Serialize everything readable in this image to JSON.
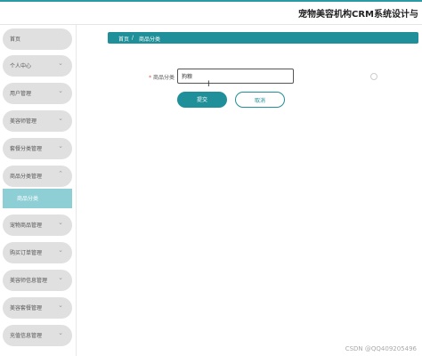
{
  "app": {
    "title": "宠物美容机构CRM系统设计与"
  },
  "sidebar": {
    "items": [
      {
        "label": "首页",
        "has_chevron": false
      },
      {
        "label": "个人中心",
        "has_chevron": true
      },
      {
        "label": "用户管理",
        "has_chevron": true
      },
      {
        "label": "美容师管理",
        "has_chevron": true
      },
      {
        "label": "套餐分类管理",
        "has_chevron": true
      },
      {
        "label": "商品分类管理",
        "has_chevron": true
      },
      {
        "label": "宠物商品管理",
        "has_chevron": true
      },
      {
        "label": "购买订单管理",
        "has_chevron": true
      },
      {
        "label": "美容师信息管理",
        "has_chevron": true
      },
      {
        "label": "美容套餐管理",
        "has_chevron": true
      },
      {
        "label": "充值信息管理",
        "has_chevron": true
      }
    ],
    "active_sub": {
      "label": "商品分类"
    }
  },
  "breadcrumb": {
    "home": "首页",
    "separator": "/",
    "current": "商品分类"
  },
  "form": {
    "label": "商品分类",
    "required_mark": "*",
    "value": "狗粮",
    "submit_label": "提交",
    "cancel_label": "取消"
  },
  "watermark": "CSDN @QQ409205496",
  "colors": {
    "accent": "#1f8f99",
    "sidebar_item": "#e0e0e0",
    "active_sub": "#8ecfd6"
  }
}
